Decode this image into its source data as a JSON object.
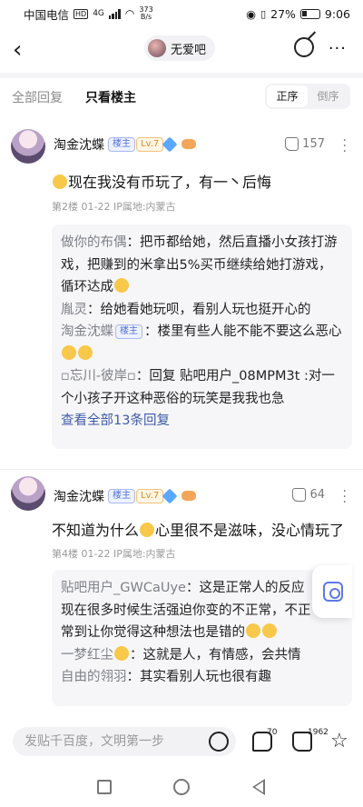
{
  "status": {
    "carrier": "中国电信",
    "hd": "HD",
    "net": "4G",
    "speed_value": "373",
    "speed_unit": "B/s",
    "battery": "27%",
    "time": "9:06"
  },
  "nav": {
    "back": "‹",
    "forum_name": "无爱吧",
    "more": "···"
  },
  "tabs": {
    "all": "全部回复",
    "op_only": "只看楼主",
    "sort_asc": "正序",
    "sort_desc": "倒序"
  },
  "posts": [
    {
      "username": "淘金沈蝶",
      "host_badge": "楼主",
      "level": "Lv.7",
      "likes": "157",
      "content": "现在我没有币玩了，有一丶后悔",
      "meta": "第2楼  01-22  IP属地:内蒙古",
      "replies": [
        {
          "name": "做你的布偶",
          "text": "把币都给她，然后直播小女孩打游戏，把赚到的米拿出5%买币继续给她打游戏，循环达成"
        },
        {
          "name": "胤灵",
          "text": "给她看她玩呗，看别人玩也挺开心的"
        },
        {
          "name": "淘金沈蝶",
          "badge": "楼主",
          "text": "楼里有些人能不能不要这么恶心"
        },
        {
          "name": "▫忘川-彼岸▫",
          "text": "回复 贴吧用户_08MPM3t :对一个小孩子开这种恶俗的玩笑是我我也急"
        }
      ],
      "view_all": "查看全部13条回复"
    },
    {
      "username": "淘金沈蝶",
      "host_badge": "楼主",
      "level": "Lv.7",
      "likes": "64",
      "content_a": "不知道为什么",
      "content_b": "心里很不是滋味，没心情玩了",
      "meta": "第4楼  01-22  IP属地:内蒙古",
      "replies": [
        {
          "name": "贴吧用户_GWCaUye",
          "text": "这是正常人的反应现在很多时候生活强迫你变的不正常，不正常到让你觉得这种想法也是错的"
        },
        {
          "name": "一梦红尘",
          "text": "这就是人，有情感，会共情"
        },
        {
          "name": "自由的翎羽",
          "text": "其实看别人玩也很有趣"
        }
      ]
    }
  ],
  "bottom": {
    "placeholder": "发贴千百度，文明第一步",
    "comments": "70",
    "likes": "1962"
  },
  "colors": {
    "accent": "#4f6fd8",
    "level": "#e08a1a",
    "link": "#3e5aa8"
  },
  "icons": [
    "back-icon",
    "share-icon",
    "more-icon",
    "thumb-icon",
    "lens-icon",
    "emoji-icon",
    "comment-icon",
    "star-icon"
  ]
}
